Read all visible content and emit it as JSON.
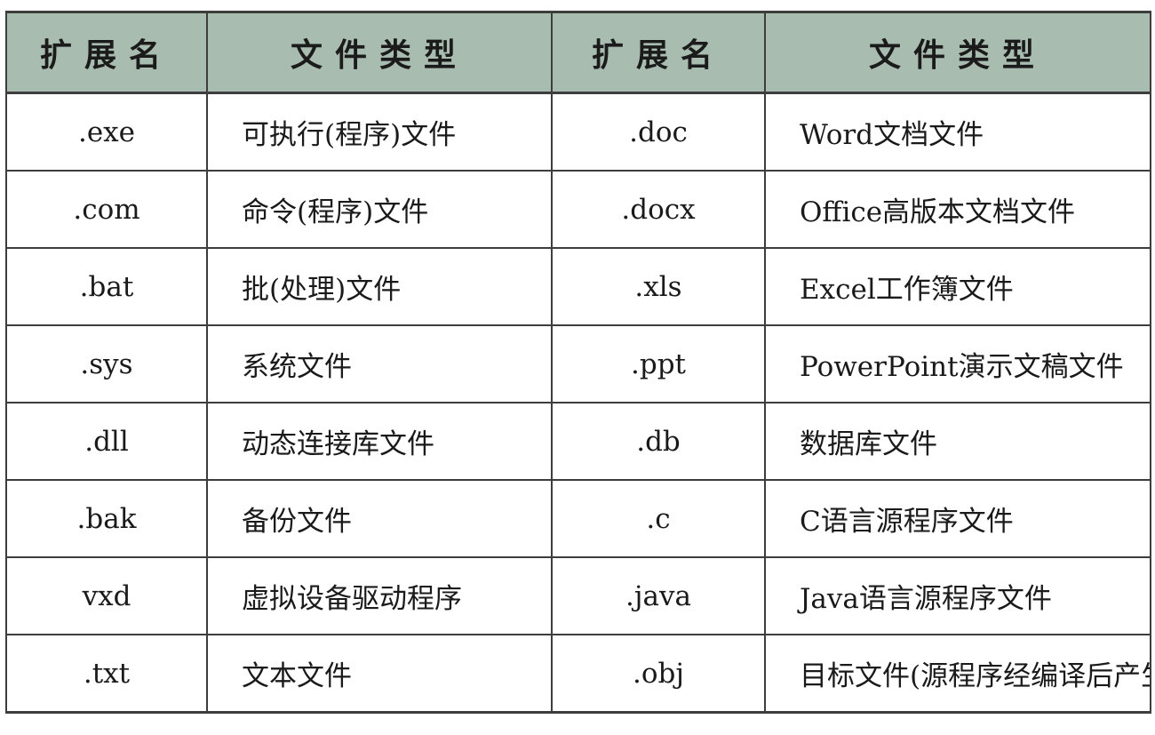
{
  "headers": [
    "扩展名",
    "文件类型",
    "扩展名",
    "文件类型"
  ],
  "rows": [
    {
      "ext1": ".exe",
      "type1": "可执行(程序)文件",
      "ext2": ".doc",
      "type2": "Word文档文件"
    },
    {
      "ext1": ".com",
      "type1": "命令(程序)文件",
      "ext2": ".docx",
      "type2": "Office高版本文档文件"
    },
    {
      "ext1": ".bat",
      "type1": "批(处理)文件",
      "ext2": ".xls",
      "type2": "Excel工作簿文件"
    },
    {
      "ext1": ".sys",
      "type1": "系统文件",
      "ext2": ".ppt",
      "type2": "PowerPoint演示文稿文件"
    },
    {
      "ext1": ".dll",
      "type1": "动态连接库文件",
      "ext2": ".db",
      "type2": "数据库文件"
    },
    {
      "ext1": ".bak",
      "type1": "备份文件",
      "ext2": ".c",
      "type2": "C语言源程序文件"
    },
    {
      "ext1": "vxd",
      "type1": "虚拟设备驱动程序",
      "ext2": ".java",
      "type2": "Java语言源程序文件"
    },
    {
      "ext1": ".txt",
      "type1": "文本文件",
      "ext2": ".obj",
      "type2": "目标文件(源程序经编译后产生)"
    }
  ],
  "colors": {
    "header_background": "#a9bcb0",
    "border": "#3d3d3d"
  }
}
